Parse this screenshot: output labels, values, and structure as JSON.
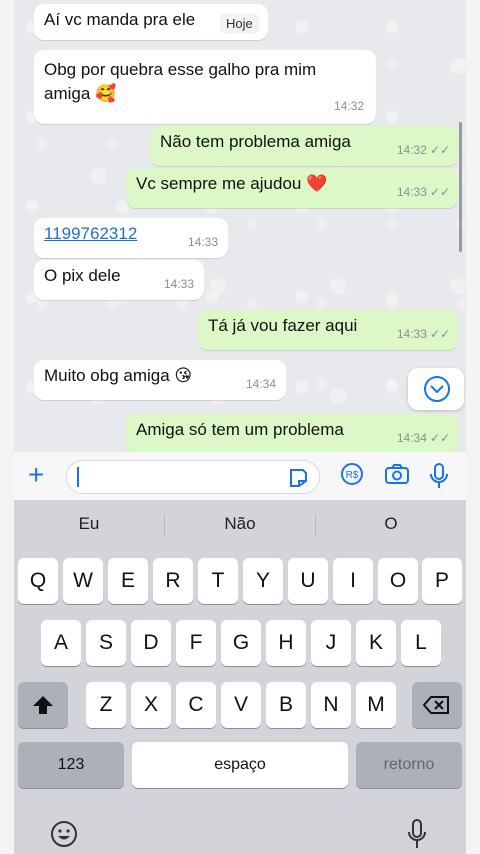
{
  "chat": {
    "messages": [
      {
        "dir": "in",
        "text": "Aí vc manda pra ele",
        "time": ""
      },
      {
        "dir": "in",
        "text": "Obg por quebra esse galho pra mim amiga 🥰",
        "time": "14:32"
      },
      {
        "dir": "out",
        "text": "Não tem problema amiga",
        "time": "14:32"
      },
      {
        "dir": "out",
        "text": "Vc sempre me ajudou ❤️",
        "time": "14:33"
      },
      {
        "dir": "in",
        "text": "1199762312",
        "time": "14:33"
      },
      {
        "dir": "in",
        "text": "O pix dele",
        "time": "14:33"
      },
      {
        "dir": "out",
        "text": "Tá já vou fazer aqui",
        "time": "14:33"
      },
      {
        "dir": "in",
        "text": "Muito obg amiga 😘",
        "time": "14:34"
      },
      {
        "dir": "out",
        "text": "Amiga só tem um problema",
        "time": "14:34"
      }
    ],
    "today_pill": "Hoje",
    "ticks": "✓✓",
    "line1": "Obg por quebra esse galho pra mim",
    "line2": "amiga 🥰"
  },
  "input": {
    "placeholder": "",
    "currency_label": "R$"
  },
  "keyboard": {
    "suggestions": [
      "Eu",
      "Não",
      "O"
    ],
    "row1": [
      "Q",
      "W",
      "E",
      "R",
      "T",
      "Y",
      "U",
      "I",
      "O",
      "P"
    ],
    "row2": [
      "A",
      "S",
      "D",
      "F",
      "G",
      "H",
      "J",
      "K",
      "L"
    ],
    "row3": [
      "Z",
      "X",
      "C",
      "V",
      "B",
      "N",
      "M"
    ],
    "numbers_label": "123",
    "space_label": "espaço",
    "return_label": "retorno"
  },
  "colors": {
    "accent": "#1a73e8",
    "outgoing": "#dcf8c6",
    "incoming": "#ffffff"
  }
}
